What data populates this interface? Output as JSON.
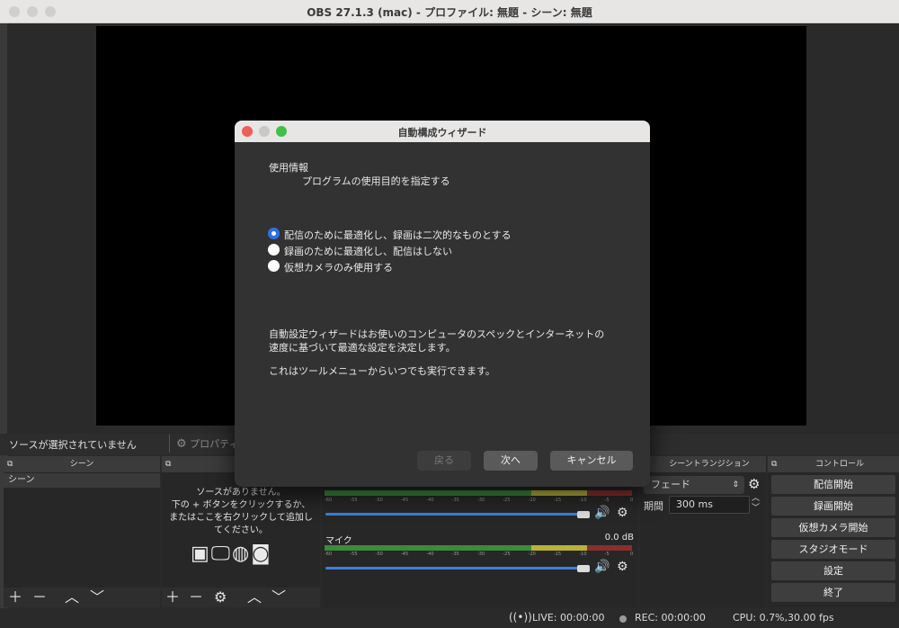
{
  "window": {
    "title": "OBS 27.1.3 (mac) - プロファイル: 無題 - シーン: 無題"
  },
  "sources_bar": {
    "no_selection": "ソースが選択されていません",
    "properties": "プロパティ"
  },
  "docks": {
    "scenes": {
      "title": "シーン",
      "items": [
        "シーン"
      ]
    },
    "sources": {
      "empty_lines": [
        "ソースがありません。",
        "下の + ボタンをクリックするか、",
        "またはここを右クリックして追加し",
        "てください。"
      ]
    },
    "mixer": {
      "ticks": [
        "-60",
        "-55",
        "-50",
        "-45",
        "-40",
        "-35",
        "-30",
        "-25",
        "-20",
        "-15",
        "-10",
        "-5",
        "0"
      ],
      "channels": [
        {
          "name": "",
          "level": ""
        },
        {
          "name": "マイク",
          "level": "0.0 dB"
        }
      ]
    },
    "transitions": {
      "title": "シーントランジション",
      "selected": "フェード",
      "duration_label": "期間",
      "duration_value": "300 ms"
    },
    "controls": {
      "title": "コントロール",
      "buttons": [
        "配信開始",
        "録画開始",
        "仮想カメラ開始",
        "スタジオモード",
        "設定",
        "終了"
      ]
    }
  },
  "status": {
    "live": "LIVE: 00:00:00",
    "rec": "REC: 00:00:00",
    "cpu": "CPU: 0.7%,30.00 fps"
  },
  "dialog": {
    "title": "自動構成ウィザード",
    "heading": "使用情報",
    "subheading": "プログラムの使用目的を指定する",
    "options": [
      {
        "label": "配信のために最適化し、録画は二次的なものとする",
        "selected": true
      },
      {
        "label": "録画のために最適化し、配信はしない",
        "selected": false
      },
      {
        "label": "仮想カメラのみ使用する",
        "selected": false
      }
    ],
    "info_line1": "自動設定ウィザードはお使いのコンピュータのスペックとインターネットの",
    "info_line2": "速度に基づいて最適な設定を決定します。",
    "info_line3": "これはツールメニューからいつでも実行できます。",
    "back_label": "戻る",
    "next_label": "次へ",
    "cancel_label": "キャンセル"
  },
  "colors": {
    "accent": "#2d6fe0",
    "meter_green": "#3c8a3c",
    "meter_yellow": "#b8b13a",
    "meter_red": "#8a2f2f"
  }
}
